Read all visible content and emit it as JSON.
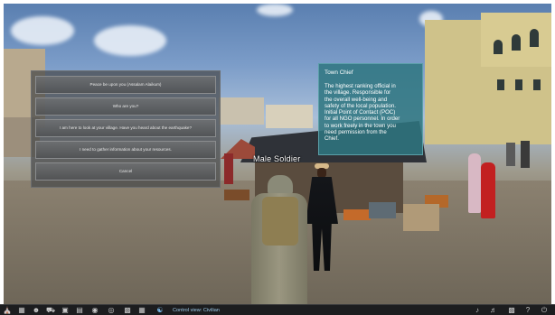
{
  "dialog": {
    "options": [
      "Peace be upon you (Assalam Alaikum)",
      "Who are you?",
      "I am here to look at your village. Have you heard about the earthquake?",
      "I need to gather information about your resources.",
      "Cancel"
    ]
  },
  "tooltip": {
    "title": "Town Chief",
    "body": "The highest ranking official in\nthe village. Responsible for\nthe overall well-being and\nsafety of the local population.\nInitial Point of Contact (POC)\nfor all NGO personnel. In order\nto work freely in the town you\nneed permission from the\nChief."
  },
  "unit_label": "Male Soldier",
  "taskbar": {
    "control_view": "Control view: Civilian",
    "left_icons": [
      "village-icon",
      "map-icon",
      "group-icon",
      "vehicle-icon",
      "inventory-icon",
      "chat-icon",
      "radio-icon",
      "camera-icon",
      "document-icon",
      "settings-icon",
      "team-icon"
    ],
    "right_icons": [
      "volume-icon",
      "microphone-icon",
      "screen-icon",
      "help-icon",
      "power-icon"
    ]
  }
}
